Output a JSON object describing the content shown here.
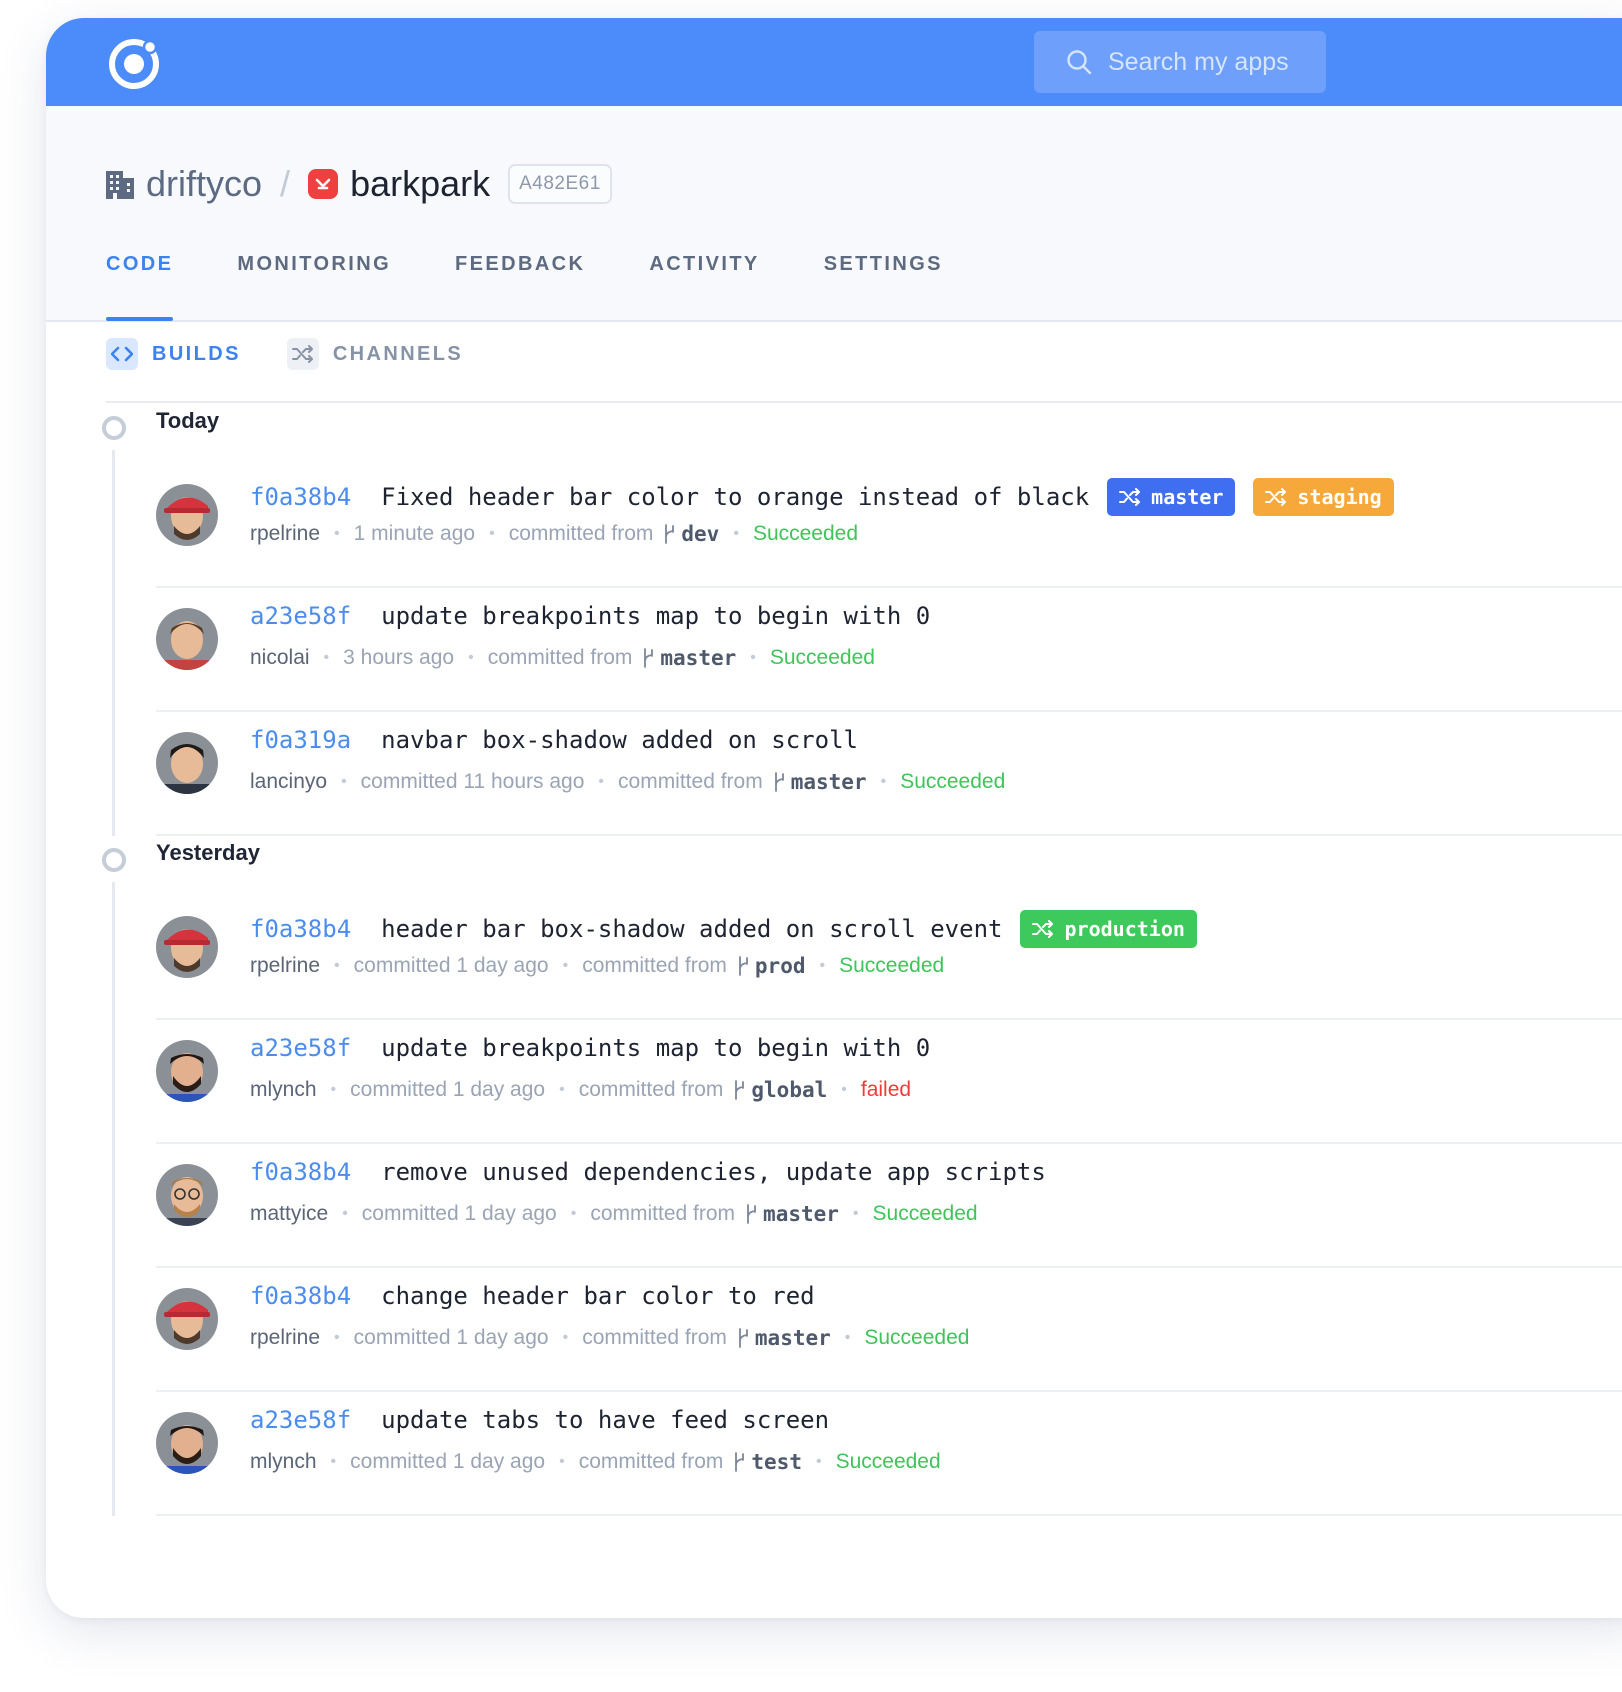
{
  "search": {
    "placeholder": "Search my apps"
  },
  "breadcrumb": {
    "org": "driftyco",
    "app": "barkpark",
    "app_id": "A482E61"
  },
  "tabs": [
    "CODE",
    "MONITORING",
    "FEEDBACK",
    "ACTIVITY",
    "SETTINGS"
  ],
  "active_tab": "CODE",
  "subtabs": [
    "BUILDS",
    "CHANNELS"
  ],
  "groups": [
    {
      "label": "Today",
      "commits": [
        {
          "hash": "f0a38b4",
          "message": "Fixed header bar color to orange instead of black",
          "author": "rpelrine",
          "time": "1 minute ago",
          "from": "committed from",
          "branch": "dev",
          "status": "Succeeded",
          "channels": [
            {
              "name": "master",
              "color": "#3f6ff0"
            },
            {
              "name": "staging",
              "color": "#f7a83a"
            }
          ],
          "avatar": "red-cap"
        },
        {
          "hash": "a23e58f",
          "message": "update breakpoints map to begin with 0",
          "author": "nicolai",
          "time": "3 hours ago",
          "from": "committed from",
          "branch": "master",
          "status": "Succeeded",
          "channels": [],
          "avatar": "brown-hair"
        },
        {
          "hash": "f0a319a",
          "message": "navbar box-shadow added on scroll",
          "author": "lancinyo",
          "time": "committed 11 hours ago",
          "from": "committed from",
          "branch": "master",
          "status": "Succeeded",
          "channels": [],
          "avatar": "dark-hair"
        }
      ]
    },
    {
      "label": "Yesterday",
      "commits": [
        {
          "hash": "f0a38b4",
          "message": "header bar box-shadow added on scroll event",
          "author": "rpelrine",
          "time": "committed 1 day ago",
          "from": "committed from",
          "branch": "prod",
          "status": "Succeeded",
          "channels": [
            {
              "name": "production",
              "color": "#3ec95c"
            }
          ],
          "avatar": "red-cap"
        },
        {
          "hash": "a23e58f",
          "message": "update breakpoints map to begin with 0",
          "author": "mlynch",
          "time": "committed 1 day ago",
          "from": "committed from",
          "branch": "global",
          "status": "failed",
          "channels": [],
          "avatar": "beard"
        },
        {
          "hash": "f0a38b4",
          "message": "remove unused dependencies, update app scripts",
          "author": "mattyice",
          "time": "committed 1 day ago",
          "from": "committed from",
          "branch": "master",
          "status": "Succeeded",
          "channels": [],
          "avatar": "glasses"
        },
        {
          "hash": "f0a38b4",
          "message": "change header bar color to red",
          "author": "rpelrine",
          "time": "committed 1 day ago",
          "from": "committed from",
          "branch": "master",
          "status": "Succeeded",
          "channels": [],
          "avatar": "red-cap"
        },
        {
          "hash": "a23e58f",
          "message": "update tabs to have feed screen",
          "author": "mlynch",
          "time": "committed 1 day ago",
          "from": "committed from",
          "branch": "test",
          "status": "Succeeded",
          "channels": [],
          "avatar": "beard"
        }
      ]
    }
  ],
  "colors": {
    "brand": "#4c8cfa",
    "link": "#4a8cf0",
    "success": "#3fc45a",
    "failure": "#f03a3a"
  },
  "icons": {
    "logo": "ionic-logo-icon",
    "search": "search-icon",
    "org": "building-icon",
    "builds": "code-icon",
    "channels": "shuffle-icon",
    "branch": "git-branch-icon"
  }
}
